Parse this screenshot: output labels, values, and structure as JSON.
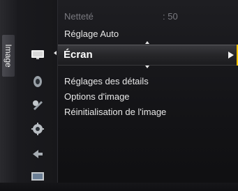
{
  "side_tab": {
    "label": "Image"
  },
  "menu": {
    "dim_item": {
      "label": "Netteté",
      "value": ": 50"
    },
    "items": [
      {
        "label": "Réglage Auto"
      },
      {
        "label": "Écran"
      },
      {
        "label": "Réglages des détails"
      },
      {
        "label": "Options d'image"
      },
      {
        "label": "Réinitialisation de l'image"
      }
    ]
  },
  "icons": [
    {
      "name": "picture-icon"
    },
    {
      "name": "sound-icon"
    },
    {
      "name": "setup-icon"
    },
    {
      "name": "settings-icon"
    },
    {
      "name": "input-icon"
    },
    {
      "name": "application-icon"
    }
  ],
  "colors": {
    "highlight_border": "#ffc400",
    "text": "#e8e8e8",
    "dim_text": "#7a7a80"
  }
}
